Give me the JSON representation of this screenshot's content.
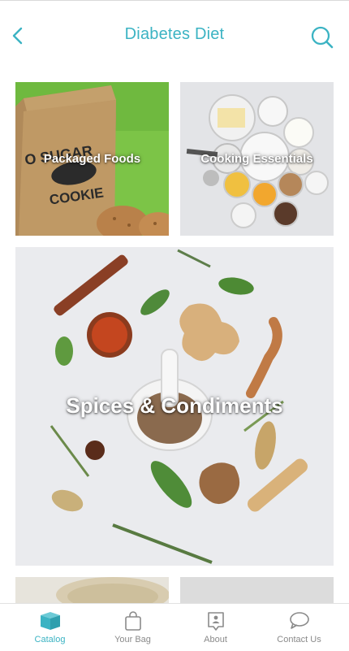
{
  "header": {
    "title": "Diabetes Diet",
    "back_icon": "chevron-left-icon",
    "search_icon": "search-icon",
    "accent_color": "#3bb3c3"
  },
  "catalog": {
    "tiles": [
      {
        "label": "Packaged Foods",
        "bag_text_1": "O SUGAR",
        "bag_text_2": "COOKIE"
      },
      {
        "label": "Cooking Essentials"
      },
      {
        "label": "Spices & Condiments"
      },
      {
        "label": ""
      },
      {
        "label": ""
      }
    ]
  },
  "tabbar": {
    "active_color": "#3bb3c3",
    "inactive_color": "#8a8a8a",
    "tabs": [
      {
        "label": "Catalog",
        "icon": "box-icon",
        "active": true
      },
      {
        "label": "Your Bag",
        "icon": "bag-icon",
        "active": false
      },
      {
        "label": "About",
        "icon": "info-icon",
        "active": false
      },
      {
        "label": "Contact Us",
        "icon": "chat-icon",
        "active": false
      }
    ]
  }
}
